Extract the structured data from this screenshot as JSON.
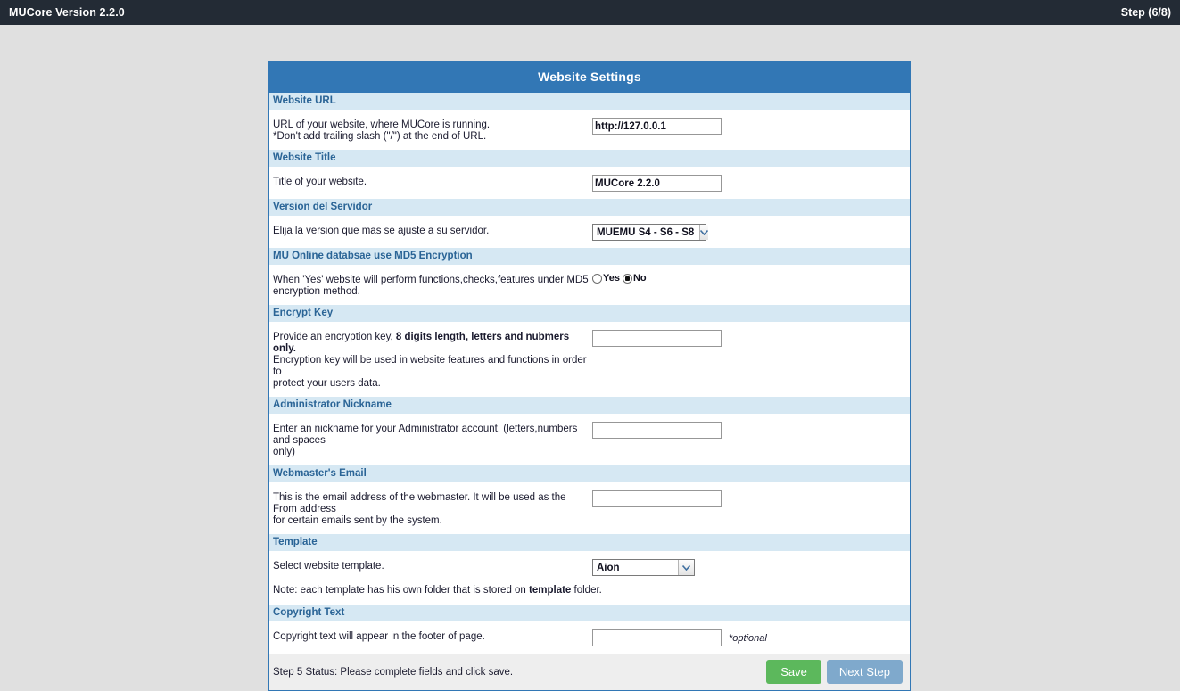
{
  "topbar": {
    "title": "MUCore Version 2.2.0",
    "step": "Step (6/8)"
  },
  "panel": {
    "header": "Website Settings",
    "sections": [
      {
        "key": "website_url",
        "heading": "Website URL",
        "desc_line1": "URL of your website, where MUCore is running.",
        "desc_line2": "*Don't add trailing slash (\"/\") at the end of URL.",
        "value": "http://127.0.0.1"
      },
      {
        "key": "website_title",
        "heading": "Website Title",
        "desc_line1": "Title of your website.",
        "value": "MUCore 2.2.0"
      },
      {
        "key": "server_version",
        "heading": "Version del Servidor",
        "desc_line1": "Elija la version que mas se ajuste a su servidor.",
        "selected": "MUEMU S4 - S6 - S8"
      },
      {
        "key": "md5_encryption",
        "heading": "MU Online databsae use MD5 Encryption",
        "desc_line1": "When 'Yes' website will perform functions,checks,features under MD5",
        "desc_line2": "encryption method.",
        "option_yes": "Yes",
        "option_no": "No",
        "selected": "No"
      },
      {
        "key": "encrypt_key",
        "heading": "Encrypt Key",
        "desc_part1": "Provide an encryption key, ",
        "desc_bold": "8 digits length, letters and nubmers only.",
        "desc_line2": "Encryption key will be used in website features and functions in order to",
        "desc_line3": "protect your users data.",
        "value": "",
        "placeholder": ""
      },
      {
        "key": "admin_nickname",
        "heading": "Administrator Nickname",
        "desc_line1": "Enter an nickname for your Administrator account. (letters,numbers and spaces",
        "desc_line2": "only)",
        "value": "",
        "placeholder": ""
      },
      {
        "key": "webmaster_email",
        "heading": "Webmaster's Email",
        "desc_line1": "This is the email address of the webmaster. It will be used as the From address",
        "desc_line2": "for certain emails sent by the system.",
        "value": "",
        "placeholder": ""
      },
      {
        "key": "template",
        "heading": "Template",
        "desc_line1": "Select website template.",
        "selected": "Aion",
        "note_part1": "Note: each template has his own folder that is stored on ",
        "note_bold": "template",
        "note_part2": " folder."
      },
      {
        "key": "copyright_text",
        "heading": "Copyright Text",
        "desc_line1": "Copyright text will appear in the footer of page.",
        "value": "",
        "placeholder": "",
        "optional_note": "*optional"
      }
    ],
    "footer": {
      "status": "Step 5 Status: Please complete fields and click save.",
      "save_label": "Save",
      "next_label": "Next Step"
    }
  },
  "colors": {
    "topbar_bg": "#232b35",
    "panel_header_bg": "#3277b5",
    "section_head_bg": "#d6e8f3",
    "section_head_text": "#2a6496",
    "page_bg": "#e0e0e0",
    "save_button": "#5cb85c",
    "next_button": "#7fa9cc",
    "footer_bg": "#eeeeee"
  }
}
